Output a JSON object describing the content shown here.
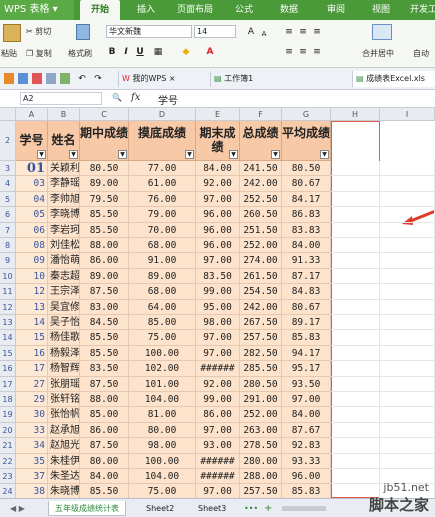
{
  "app": {
    "name": "WPS 表格"
  },
  "menu_tabs": [
    {
      "label": "开始",
      "active": true
    },
    {
      "label": "插入"
    },
    {
      "label": "页面布局"
    },
    {
      "label": "公式"
    },
    {
      "label": "数据"
    },
    {
      "label": "审阅"
    },
    {
      "label": "视图"
    },
    {
      "label": "开发工"
    }
  ],
  "ribbon": {
    "paste": "粘贴",
    "cut": "剪切",
    "copy": "复制",
    "format_painter": "格式刷",
    "font_name": "华文新魏",
    "font_size": "14",
    "merge_center": "合并居中",
    "auto": "自动"
  },
  "doc_tabs": [
    {
      "label": "我的WPS"
    },
    {
      "label": "工作簿1"
    },
    {
      "label": "成绩表Excel.xls"
    }
  ],
  "formula_bar": {
    "cell_ref": "A2",
    "fx": "fx",
    "value": "学号"
  },
  "columns": [
    "A",
    "B",
    "C",
    "D",
    "E",
    "F",
    "G",
    "H",
    "I"
  ],
  "header_row": {
    "row": "2",
    "cells": [
      "学号",
      "姓名",
      "期中成绩",
      "摸底成绩",
      "期末成绩",
      "总成绩",
      "平均成绩"
    ]
  },
  "rows": [
    {
      "row": "3",
      "id": "01",
      "name": "关颖利",
      "c": "80.50",
      "d": "77.00",
      "e": "84.00",
      "f": "241.50",
      "g": "80.50"
    },
    {
      "row": "4",
      "id": "03",
      "name": "李静瑶",
      "c": "89.00",
      "d": "61.00",
      "e": "92.00",
      "f": "242.00",
      "g": "80.67"
    },
    {
      "row": "5",
      "id": "04",
      "name": "李帅旭",
      "c": "79.50",
      "d": "76.00",
      "e": "97.00",
      "f": "252.50",
      "g": "84.17"
    },
    {
      "row": "6",
      "id": "05",
      "name": "李晓博",
      "c": "85.50",
      "d": "79.00",
      "e": "96.00",
      "f": "260.50",
      "g": "86.83"
    },
    {
      "row": "7",
      "id": "06",
      "name": "李岩珂",
      "c": "85.50",
      "d": "70.00",
      "e": "96.00",
      "f": "251.50",
      "g": "83.83"
    },
    {
      "row": "8",
      "id": "08",
      "name": "刘佳松",
      "c": "88.00",
      "d": "68.00",
      "e": "96.00",
      "f": "252.00",
      "g": "84.00"
    },
    {
      "row": "9",
      "id": "09",
      "name": "潘怡萌",
      "c": "86.00",
      "d": "91.00",
      "e": "97.00",
      "f": "274.00",
      "g": "91.33"
    },
    {
      "row": "10",
      "id": "10",
      "name": "秦志超",
      "c": "89.00",
      "d": "89.00",
      "e": "83.50",
      "f": "261.50",
      "g": "87.17"
    },
    {
      "row": "11",
      "id": "12",
      "name": "王宗泽",
      "c": "87.50",
      "d": "68.00",
      "e": "99.00",
      "f": "254.50",
      "g": "84.83"
    },
    {
      "row": "12",
      "id": "13",
      "name": "吴宜修",
      "c": "83.00",
      "d": "64.00",
      "e": "95.00",
      "f": "242.00",
      "g": "80.67"
    },
    {
      "row": "13",
      "id": "14",
      "name": "吴子怡",
      "c": "84.50",
      "d": "85.00",
      "e": "98.00",
      "f": "267.50",
      "g": "89.17"
    },
    {
      "row": "14",
      "id": "15",
      "name": "杨佳歌",
      "c": "85.50",
      "d": "75.00",
      "e": "97.00",
      "f": "257.50",
      "g": "85.83"
    },
    {
      "row": "15",
      "id": "16",
      "name": "杨毅泽",
      "c": "85.50",
      "d": "100.00",
      "e": "97.00",
      "f": "282.50",
      "g": "94.17"
    },
    {
      "row": "16",
      "id": "17",
      "name": "杨智辉",
      "c": "83.50",
      "d": "102.00",
      "e": "######",
      "f": "285.50",
      "g": "95.17"
    },
    {
      "row": "17",
      "id": "27",
      "name": "张朋瑶",
      "c": "87.50",
      "d": "101.00",
      "e": "92.00",
      "f": "280.50",
      "g": "93.50"
    },
    {
      "row": "18",
      "id": "29",
      "name": "张轩铭",
      "c": "88.00",
      "d": "104.00",
      "e": "99.00",
      "f": "291.00",
      "g": "97.00"
    },
    {
      "row": "19",
      "id": "30",
      "name": "张怡帆",
      "c": "85.00",
      "d": "81.00",
      "e": "86.00",
      "f": "252.00",
      "g": "84.00"
    },
    {
      "row": "20",
      "id": "33",
      "name": "赵承旭",
      "c": "86.00",
      "d": "80.00",
      "e": "97.00",
      "f": "263.00",
      "g": "87.67"
    },
    {
      "row": "21",
      "id": "34",
      "name": "赵旭光",
      "c": "87.50",
      "d": "98.00",
      "e": "93.00",
      "f": "278.50",
      "g": "92.83"
    },
    {
      "row": "22",
      "id": "35",
      "name": "朱桂伊",
      "c": "80.00",
      "d": "100.00",
      "e": "######",
      "f": "280.00",
      "g": "93.33"
    },
    {
      "row": "23",
      "id": "37",
      "name": "朱圣达",
      "c": "84.00",
      "d": "104.00",
      "e": "######",
      "f": "288.00",
      "g": "96.00"
    },
    {
      "row": "24",
      "id": "38",
      "name": "朱晓博",
      "c": "85.50",
      "d": "75.00",
      "e": "97.00",
      "f": "257.50",
      "g": "85.83"
    },
    {
      "row": "25",
      "id": "39",
      "name": "朱泽晨",
      "c": "88.50",
      "d": "79.00",
      "e": "95.00",
      "f": "263.50",
      "g": "87.83"
    }
  ],
  "left_row_labels": [
    "1",
    "2",
    "3",
    "4",
    "5",
    "6",
    "7",
    "8",
    "9",
    "10",
    "11",
    "12",
    "13",
    "14",
    "15",
    "16",
    "17",
    "18",
    "19",
    "20",
    "21",
    "22",
    "23",
    "24"
  ],
  "sheet_tabs": [
    {
      "label": "五年级成绩统计表",
      "active": true
    },
    {
      "label": "Sheet2"
    },
    {
      "label": "Sheet3"
    }
  ],
  "sheet_nav": "•••",
  "add_sheet": "+",
  "watermark": {
    "line1": "jb51.net",
    "line2": "脚本之家"
  },
  "colors": {
    "header_fill": "#f7c9a7",
    "data_fill": "#fde3cc",
    "border_green": "#2e8a3a",
    "accent_red": "#e03a2a"
  }
}
